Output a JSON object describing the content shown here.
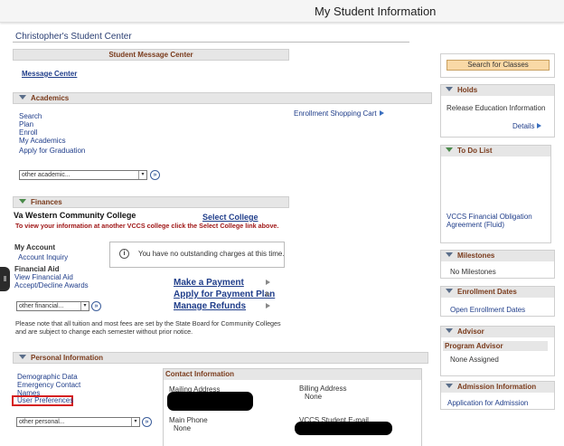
{
  "header": {
    "title": "My Student Information"
  },
  "page_title": "Christopher's Student Center",
  "message_center": {
    "header": "Student Message Center",
    "link": "Message Center"
  },
  "academics": {
    "header": "Academics",
    "links": [
      "Search",
      "Plan",
      "Enroll",
      "My Academics"
    ],
    "apply_link": "Apply for Graduation",
    "shopping_cart": "Enrollment Shopping Cart",
    "select_value": "other academic..."
  },
  "finances": {
    "header": "Finances",
    "college": "Va Western Community College",
    "select_college": "Select College",
    "notice": "To view your information at another VCCS college click the Select College link above.",
    "my_account": "My Account",
    "account_inquiry": "Account Inquiry",
    "charges_text": "You have no outstanding charges at this time.",
    "financial_aid": "Financial Aid",
    "view_aid": "View Financial Aid",
    "accept_awards": "Accept/Decline Awards",
    "make_payment": "Make a Payment",
    "payment_plan": "Apply for Payment Plan",
    "manage_refunds": "Manage Refunds",
    "select_value": "other financial...",
    "note": "Please note that all tuition and most fees are set by the State Board for Community Colleges and are subject to change each semester without prior notice."
  },
  "personal": {
    "header": "Personal Information",
    "links": [
      "Demographic Data",
      "Emergency Contact",
      "Names",
      "User Preferences"
    ],
    "select_value": "other personal...",
    "contact_header": "Contact Information",
    "mailing_label": "Mailing Address",
    "billing_label": "Billing Address",
    "billing_value": "None",
    "phone_label": "Main Phone",
    "phone_value": "None",
    "email_label": "VCCS Student E-mail"
  },
  "sidebar": {
    "search_button": "Search for Classes",
    "holds": {
      "header": "Holds",
      "item": "Release Education Information",
      "details": "Details"
    },
    "todo": {
      "header": "To Do List",
      "item": "VCCS Financial Obligation Agreement (Fluid)"
    },
    "milestones": {
      "header": "Milestones",
      "value": "No Milestones"
    },
    "enrollment_dates": {
      "header": "Enrollment Dates",
      "link": "Open Enrollment Dates"
    },
    "advisor": {
      "header": "Advisor",
      "program_label": "Program Advisor",
      "value": "None Assigned"
    },
    "admission": {
      "header": "Admission Information",
      "link": "Application for Admission"
    }
  },
  "colors": {
    "accent": "#1f3d8a",
    "section_title": "#7a3b1c",
    "button_bg": "#f9d9a6",
    "highlight_box": "#d62020"
  }
}
